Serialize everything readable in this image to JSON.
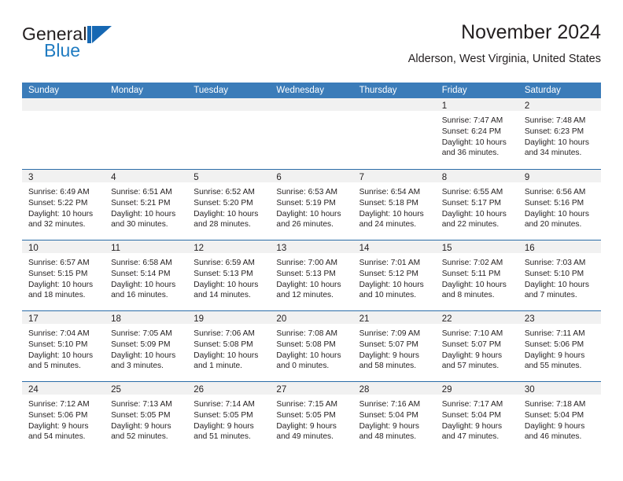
{
  "brand": {
    "name_part1": "General",
    "name_part2": "Blue",
    "accent_color": "#1668b3"
  },
  "header": {
    "title": "November 2024",
    "subtitle": "Alderson, West Virginia, United States"
  },
  "theme": {
    "header_blue": "#3b7cb9",
    "row_divider_blue": "#2b6ca8",
    "day_band_gray": "#f1f1f1",
    "text_color": "#231f20"
  },
  "calendar": {
    "weekday_headers": [
      "Sunday",
      "Monday",
      "Tuesday",
      "Wednesday",
      "Thursday",
      "Friday",
      "Saturday"
    ],
    "weeks": [
      [
        {
          "day": "",
          "lines": []
        },
        {
          "day": "",
          "lines": []
        },
        {
          "day": "",
          "lines": []
        },
        {
          "day": "",
          "lines": []
        },
        {
          "day": "",
          "lines": []
        },
        {
          "day": "1",
          "lines": [
            "Sunrise: 7:47 AM",
            "Sunset: 6:24 PM",
            "Daylight: 10 hours",
            "and 36 minutes."
          ]
        },
        {
          "day": "2",
          "lines": [
            "Sunrise: 7:48 AM",
            "Sunset: 6:23 PM",
            "Daylight: 10 hours",
            "and 34 minutes."
          ]
        }
      ],
      [
        {
          "day": "3",
          "lines": [
            "Sunrise: 6:49 AM",
            "Sunset: 5:22 PM",
            "Daylight: 10 hours",
            "and 32 minutes."
          ]
        },
        {
          "day": "4",
          "lines": [
            "Sunrise: 6:51 AM",
            "Sunset: 5:21 PM",
            "Daylight: 10 hours",
            "and 30 minutes."
          ]
        },
        {
          "day": "5",
          "lines": [
            "Sunrise: 6:52 AM",
            "Sunset: 5:20 PM",
            "Daylight: 10 hours",
            "and 28 minutes."
          ]
        },
        {
          "day": "6",
          "lines": [
            "Sunrise: 6:53 AM",
            "Sunset: 5:19 PM",
            "Daylight: 10 hours",
            "and 26 minutes."
          ]
        },
        {
          "day": "7",
          "lines": [
            "Sunrise: 6:54 AM",
            "Sunset: 5:18 PM",
            "Daylight: 10 hours",
            "and 24 minutes."
          ]
        },
        {
          "day": "8",
          "lines": [
            "Sunrise: 6:55 AM",
            "Sunset: 5:17 PM",
            "Daylight: 10 hours",
            "and 22 minutes."
          ]
        },
        {
          "day": "9",
          "lines": [
            "Sunrise: 6:56 AM",
            "Sunset: 5:16 PM",
            "Daylight: 10 hours",
            "and 20 minutes."
          ]
        }
      ],
      [
        {
          "day": "10",
          "lines": [
            "Sunrise: 6:57 AM",
            "Sunset: 5:15 PM",
            "Daylight: 10 hours",
            "and 18 minutes."
          ]
        },
        {
          "day": "11",
          "lines": [
            "Sunrise: 6:58 AM",
            "Sunset: 5:14 PM",
            "Daylight: 10 hours",
            "and 16 minutes."
          ]
        },
        {
          "day": "12",
          "lines": [
            "Sunrise: 6:59 AM",
            "Sunset: 5:13 PM",
            "Daylight: 10 hours",
            "and 14 minutes."
          ]
        },
        {
          "day": "13",
          "lines": [
            "Sunrise: 7:00 AM",
            "Sunset: 5:13 PM",
            "Daylight: 10 hours",
            "and 12 minutes."
          ]
        },
        {
          "day": "14",
          "lines": [
            "Sunrise: 7:01 AM",
            "Sunset: 5:12 PM",
            "Daylight: 10 hours",
            "and 10 minutes."
          ]
        },
        {
          "day": "15",
          "lines": [
            "Sunrise: 7:02 AM",
            "Sunset: 5:11 PM",
            "Daylight: 10 hours",
            "and 8 minutes."
          ]
        },
        {
          "day": "16",
          "lines": [
            "Sunrise: 7:03 AM",
            "Sunset: 5:10 PM",
            "Daylight: 10 hours",
            "and 7 minutes."
          ]
        }
      ],
      [
        {
          "day": "17",
          "lines": [
            "Sunrise: 7:04 AM",
            "Sunset: 5:10 PM",
            "Daylight: 10 hours",
            "and 5 minutes."
          ]
        },
        {
          "day": "18",
          "lines": [
            "Sunrise: 7:05 AM",
            "Sunset: 5:09 PM",
            "Daylight: 10 hours",
            "and 3 minutes."
          ]
        },
        {
          "day": "19",
          "lines": [
            "Sunrise: 7:06 AM",
            "Sunset: 5:08 PM",
            "Daylight: 10 hours",
            "and 1 minute."
          ]
        },
        {
          "day": "20",
          "lines": [
            "Sunrise: 7:08 AM",
            "Sunset: 5:08 PM",
            "Daylight: 10 hours",
            "and 0 minutes."
          ]
        },
        {
          "day": "21",
          "lines": [
            "Sunrise: 7:09 AM",
            "Sunset: 5:07 PM",
            "Daylight: 9 hours",
            "and 58 minutes."
          ]
        },
        {
          "day": "22",
          "lines": [
            "Sunrise: 7:10 AM",
            "Sunset: 5:07 PM",
            "Daylight: 9 hours",
            "and 57 minutes."
          ]
        },
        {
          "day": "23",
          "lines": [
            "Sunrise: 7:11 AM",
            "Sunset: 5:06 PM",
            "Daylight: 9 hours",
            "and 55 minutes."
          ]
        }
      ],
      [
        {
          "day": "24",
          "lines": [
            "Sunrise: 7:12 AM",
            "Sunset: 5:06 PM",
            "Daylight: 9 hours",
            "and 54 minutes."
          ]
        },
        {
          "day": "25",
          "lines": [
            "Sunrise: 7:13 AM",
            "Sunset: 5:05 PM",
            "Daylight: 9 hours",
            "and 52 minutes."
          ]
        },
        {
          "day": "26",
          "lines": [
            "Sunrise: 7:14 AM",
            "Sunset: 5:05 PM",
            "Daylight: 9 hours",
            "and 51 minutes."
          ]
        },
        {
          "day": "27",
          "lines": [
            "Sunrise: 7:15 AM",
            "Sunset: 5:05 PM",
            "Daylight: 9 hours",
            "and 49 minutes."
          ]
        },
        {
          "day": "28",
          "lines": [
            "Sunrise: 7:16 AM",
            "Sunset: 5:04 PM",
            "Daylight: 9 hours",
            "and 48 minutes."
          ]
        },
        {
          "day": "29",
          "lines": [
            "Sunrise: 7:17 AM",
            "Sunset: 5:04 PM",
            "Daylight: 9 hours",
            "and 47 minutes."
          ]
        },
        {
          "day": "30",
          "lines": [
            "Sunrise: 7:18 AM",
            "Sunset: 5:04 PM",
            "Daylight: 9 hours",
            "and 46 minutes."
          ]
        }
      ]
    ]
  }
}
